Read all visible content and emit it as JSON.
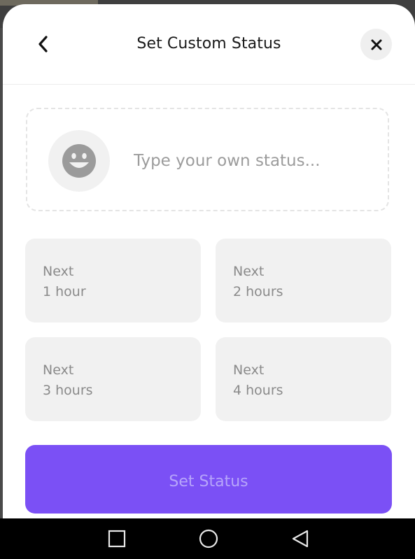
{
  "header": {
    "title": "Set Custom Status",
    "back_icon": "chevron-left-icon",
    "close_icon": "close-icon"
  },
  "status_input": {
    "emoji_icon": "smiley-face-icon",
    "placeholder": "Type your own status...",
    "value": ""
  },
  "durations": [
    {
      "line1": "Next",
      "line2": "1 hour"
    },
    {
      "line1": "Next",
      "line2": "2 hours"
    },
    {
      "line1": "Next",
      "line2": "3 hours"
    },
    {
      "line1": "Next",
      "line2": "4 hours"
    }
  ],
  "submit": {
    "label": "Set Status",
    "color": "#7b50f5"
  },
  "system_nav": {
    "recents_icon": "square-icon",
    "home_icon": "circle-icon",
    "back_icon": "triangle-back-icon"
  }
}
